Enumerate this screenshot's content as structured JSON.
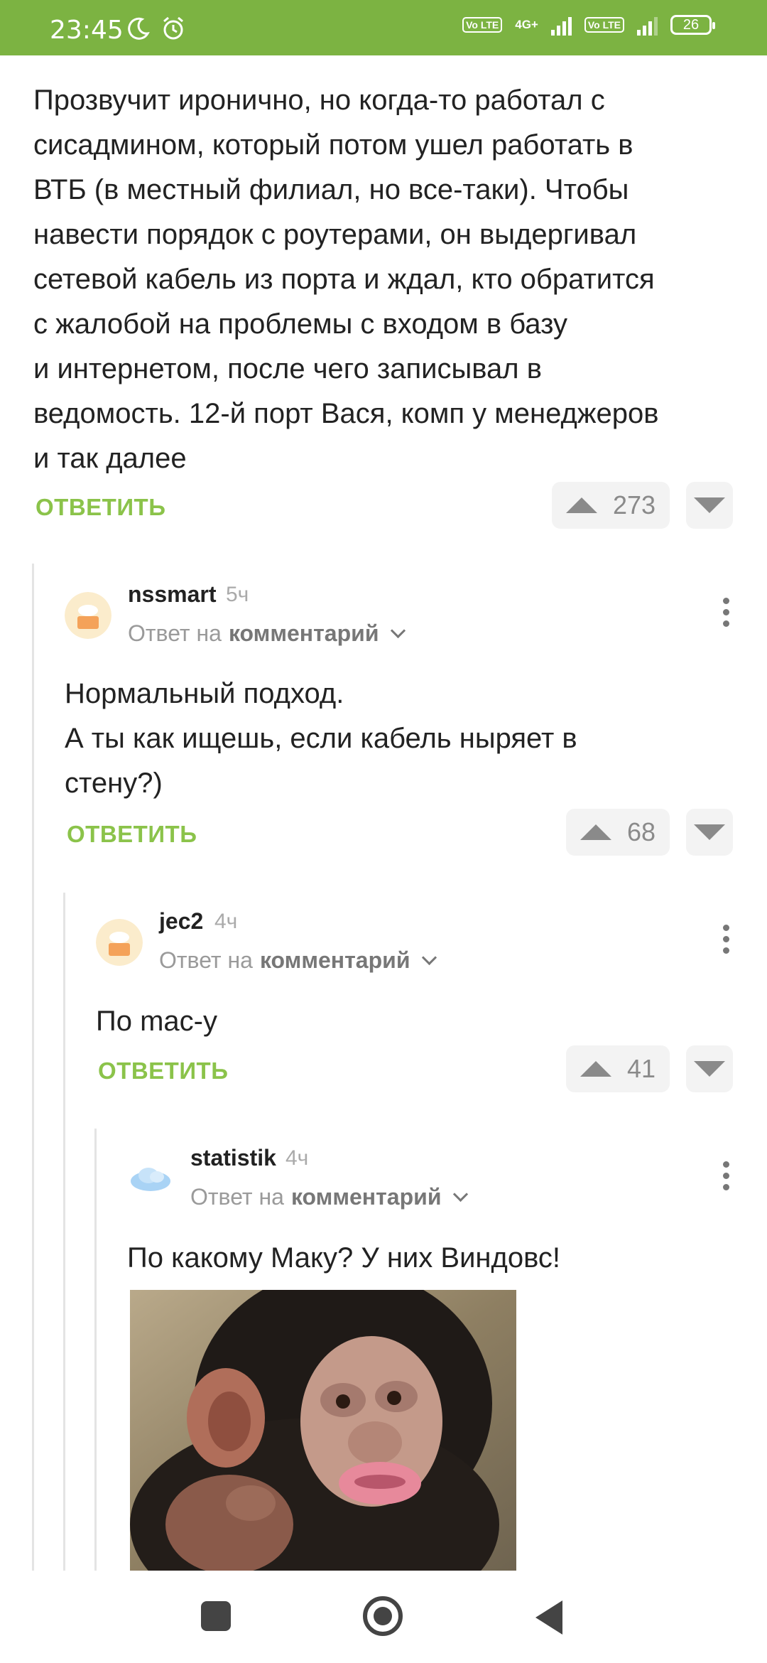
{
  "status_bar": {
    "time": "23:45",
    "network": "4G+",
    "battery": "26",
    "volte1": "Vo LTE",
    "volte2": "Vo LTE"
  },
  "comments": [
    {
      "id": "root",
      "text": "Прозвучит иронично, но когда-то работал с\nсисадмином, который потом ушел работать в\nВТБ (в местный филиал, но все-таки). Чтобы\nнавести порядок с роутерами, он выдергивал\nсетевой кабель из порта и ждал, кто обратится\nс жалобой на проблемы с входом в базу\nи интернетом, после чего записывал в\nведомость. 12-й порт Вася, комп у менеджеров\nи так далее",
      "reply_label": "ОТВЕТИТЬ",
      "rating": "273"
    },
    {
      "id": "c1",
      "username": "nssmart",
      "time": "5ч",
      "reply_to_prefix": "Ответ на",
      "reply_to_target": "комментарий",
      "text": "Нормальный подход.\nА ты как ищешь, если кабель ныряет в\nстену?)",
      "reply_label": "ОТВЕТИТЬ",
      "rating": "68"
    },
    {
      "id": "c2",
      "username": "jec2",
      "time": "4ч",
      "reply_to_prefix": "Ответ на",
      "reply_to_target": "комментарий",
      "text": "По mac-у",
      "reply_label": "ОТВЕТИТЬ",
      "rating": "41"
    },
    {
      "id": "c3",
      "username": "statistik",
      "time": "4ч",
      "reply_to_prefix": "Ответ на",
      "reply_to_target": "комментарий",
      "text": "По какому Маку? У них Виндовс!",
      "image": "chimpanzee-photo"
    }
  ],
  "icons": {
    "moon": "moon-icon",
    "alarm": "alarm-icon",
    "more": "more-vert-icon",
    "up": "upvote-icon",
    "down": "downvote-icon"
  },
  "colors": {
    "accent": "#7cb342",
    "reply": "#8bc34a"
  }
}
